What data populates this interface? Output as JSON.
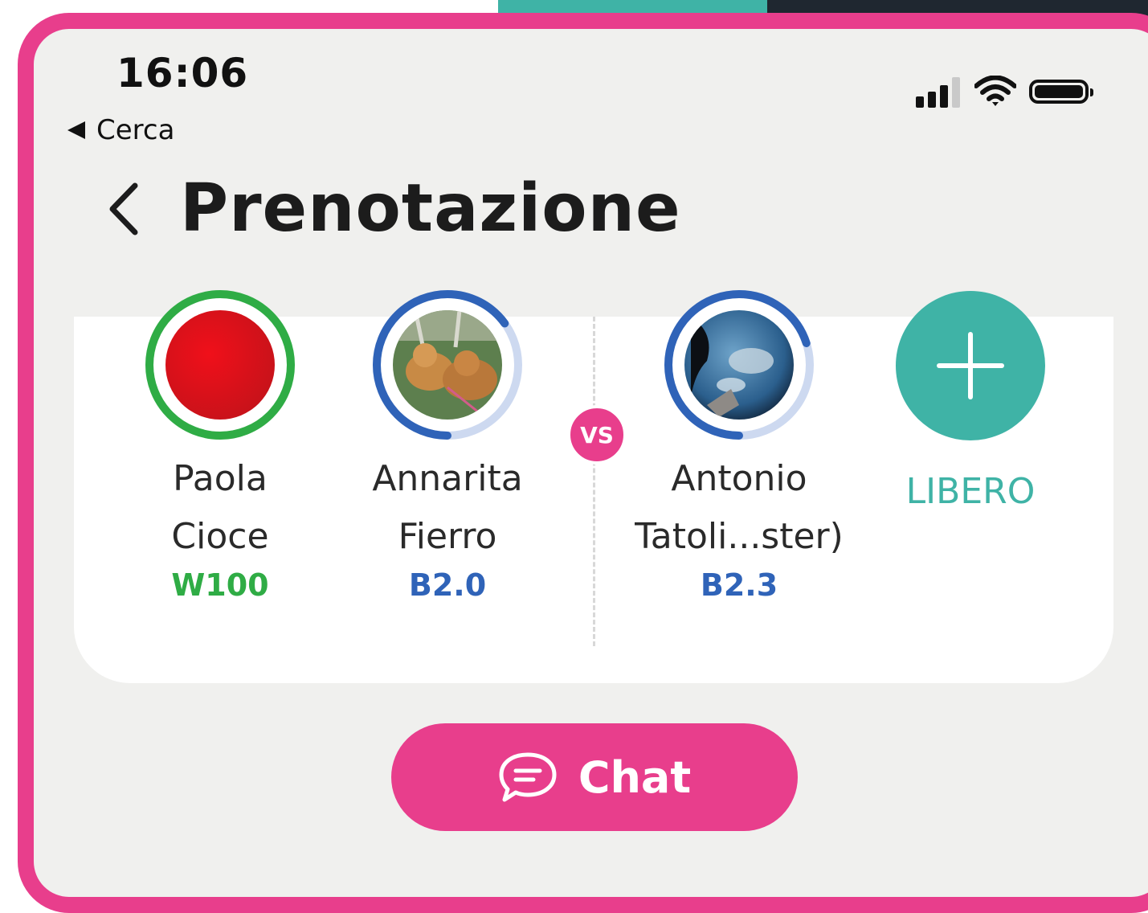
{
  "status_bar": {
    "time": "16:06",
    "back_app_label": "Cerca",
    "signal_bars_active": 3,
    "signal_bars_total": 4
  },
  "header": {
    "title": "Prenotazione"
  },
  "match": {
    "vs_label": "VS",
    "players": [
      {
        "first": "Paola",
        "last": "Cioce",
        "level": "W100",
        "level_color": "#2fac45",
        "ring_color": "#2fac45",
        "ring_track": "#cfeed5",
        "progress": 1.0,
        "avatar": "red-circle"
      },
      {
        "first": "Annarita",
        "last": "Fierro",
        "level": "B2.0",
        "level_color": "#2f63b8",
        "ring_color": "#2f63b8",
        "ring_track": "#cdd9f0",
        "progress": 0.65,
        "avatar": "dogs-photo"
      },
      {
        "first": "Antonio",
        "last": "Tatoli...ster)",
        "level": "B2.3",
        "level_color": "#2f63b8",
        "ring_color": "#2f63b8",
        "ring_track": "#cdd9f0",
        "progress": 0.7,
        "avatar": "earth-photo"
      }
    ],
    "free_slot": {
      "label": "LIBERO",
      "icon": "plus-icon",
      "color": "#3fb3a6"
    }
  },
  "actions": {
    "chat_label": "Chat",
    "chat_icon": "chat-bubble-icon"
  },
  "colors": {
    "accent": "#e83e8c",
    "teal": "#3fb3a6"
  }
}
